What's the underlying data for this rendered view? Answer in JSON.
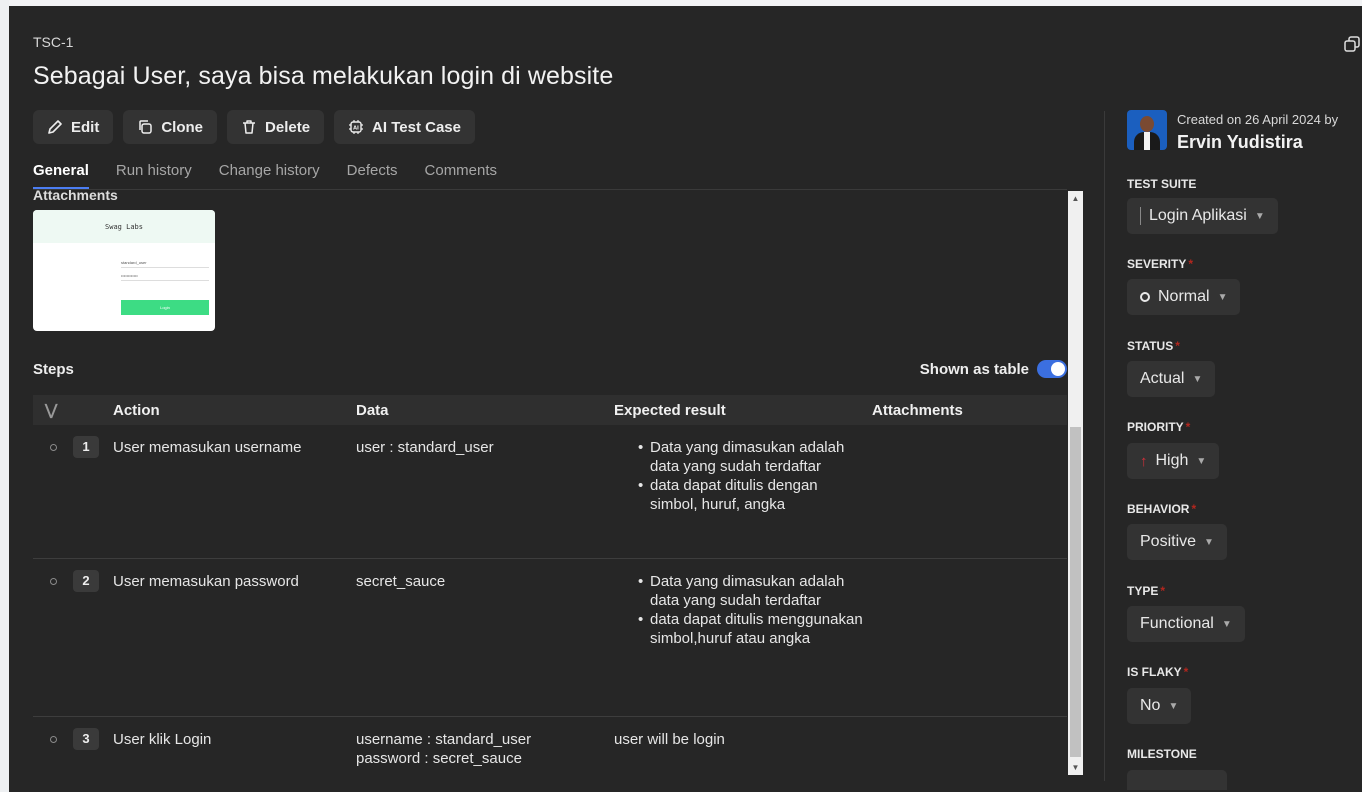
{
  "case": {
    "id": "TSC-1",
    "title": "Sebagai User, saya bisa melakukan login di website"
  },
  "toolbar": {
    "edit": "Edit",
    "clone": "Clone",
    "delete": "Delete",
    "ai_test_case": "AI Test Case"
  },
  "tabs": [
    "General",
    "Run history",
    "Change history",
    "Defects",
    "Comments"
  ],
  "attachments": {
    "title": "Attachments",
    "thumbnail": {
      "header": "Swag Labs",
      "username_hint": "standard_user",
      "password_hint": "••••••••••••",
      "button": "Login"
    }
  },
  "steps": {
    "label": "Steps",
    "shown_as_table": "Shown as table",
    "toggle_on": true,
    "columns": [
      "Action",
      "Data",
      "Expected result",
      "Attachments"
    ],
    "rows": [
      {
        "num": "1",
        "action": "User memasukan username",
        "data": [
          "user : standard_user"
        ],
        "expected": [
          "Data yang dimasukan adalah data yang sudah terdaftar",
          "data dapat ditulis dengan simbol, huruf, angka"
        ]
      },
      {
        "num": "2",
        "action": "User memasukan password",
        "data": [
          "secret_sauce"
        ],
        "expected": [
          "Data yang dimasukan adalah data yang sudah terdaftar",
          "data dapat ditulis menggunakan simbol,huruf atau angka"
        ]
      },
      {
        "num": "3",
        "action": "User klik Login",
        "data": [
          "username : standard_user",
          "password : secret_sauce"
        ],
        "expected_text": "user will be login"
      }
    ]
  },
  "sidebar": {
    "created_text": "Created on 26 April 2024 by",
    "creator": "Ervin Yudistira",
    "test_suite_label": "TEST SUITE",
    "test_suite_value": "Login Aplikasi",
    "severity_label": "SEVERITY",
    "severity_value": "Normal",
    "status_label": "STATUS",
    "status_value": "Actual",
    "priority_label": "PRIORITY",
    "priority_value": "High",
    "behavior_label": "BEHAVIOR",
    "behavior_value": "Positive",
    "type_label": "TYPE",
    "type_value": "Functional",
    "flaky_label": "IS FLAKY",
    "flaky_value": "No",
    "milestone_label": "MILESTONE"
  },
  "colors": {
    "panel_bg": "#262626",
    "accent": "#4c7ef3",
    "required": "#b3261e",
    "priority_high": "#d0303a"
  }
}
